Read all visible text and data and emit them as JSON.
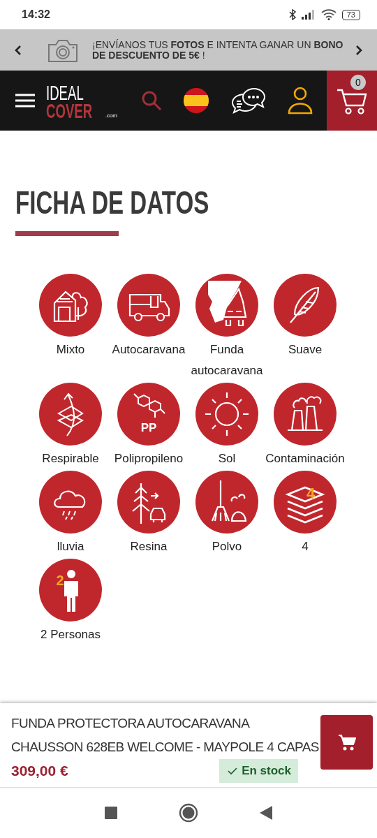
{
  "status_bar": {
    "time": "14:32",
    "battery": "73"
  },
  "promo_banner": {
    "text": "¡ENVÍANOS TUS **FOTOS** E INTENTA GANAR UN **BONO DE DESCUENTO DE 5€** !"
  },
  "header": {
    "logo_top": "IDEAL",
    "logo_bottom": "COVER",
    "logo_suffix": ".com",
    "cart_count": "0"
  },
  "section": {
    "title": "FICHA DE DATOS"
  },
  "features": [
    {
      "kind": "mixed",
      "label": "Mixto"
    },
    {
      "kind": "motorhome",
      "label": "Autocaravana"
    },
    {
      "kind": "cover",
      "label": "Funda autocaravana"
    },
    {
      "kind": "feather",
      "label": "Suave"
    },
    {
      "kind": "breathable",
      "label": "Respirable"
    },
    {
      "kind": "polymer",
      "label": "Polipropileno",
      "badge": "PP"
    },
    {
      "kind": "sun",
      "label": "Sol"
    },
    {
      "kind": "pollution",
      "label": "Contaminación"
    },
    {
      "kind": "rain",
      "label": "lluvia"
    },
    {
      "kind": "resin",
      "label": "Resina"
    },
    {
      "kind": "dust",
      "label": "Polvo"
    },
    {
      "kind": "layers",
      "label": "4",
      "badge": "4"
    },
    {
      "kind": "person",
      "label": "2 Personas",
      "badge": "2"
    }
  ],
  "product_bar": {
    "title": "FUNDA PROTECTORA AUTOCARAVANA CHAUSSON 628EB WELCOME - MAYPOLE 4 CAPAS",
    "price": "309,00 €",
    "stock": "En stock"
  }
}
